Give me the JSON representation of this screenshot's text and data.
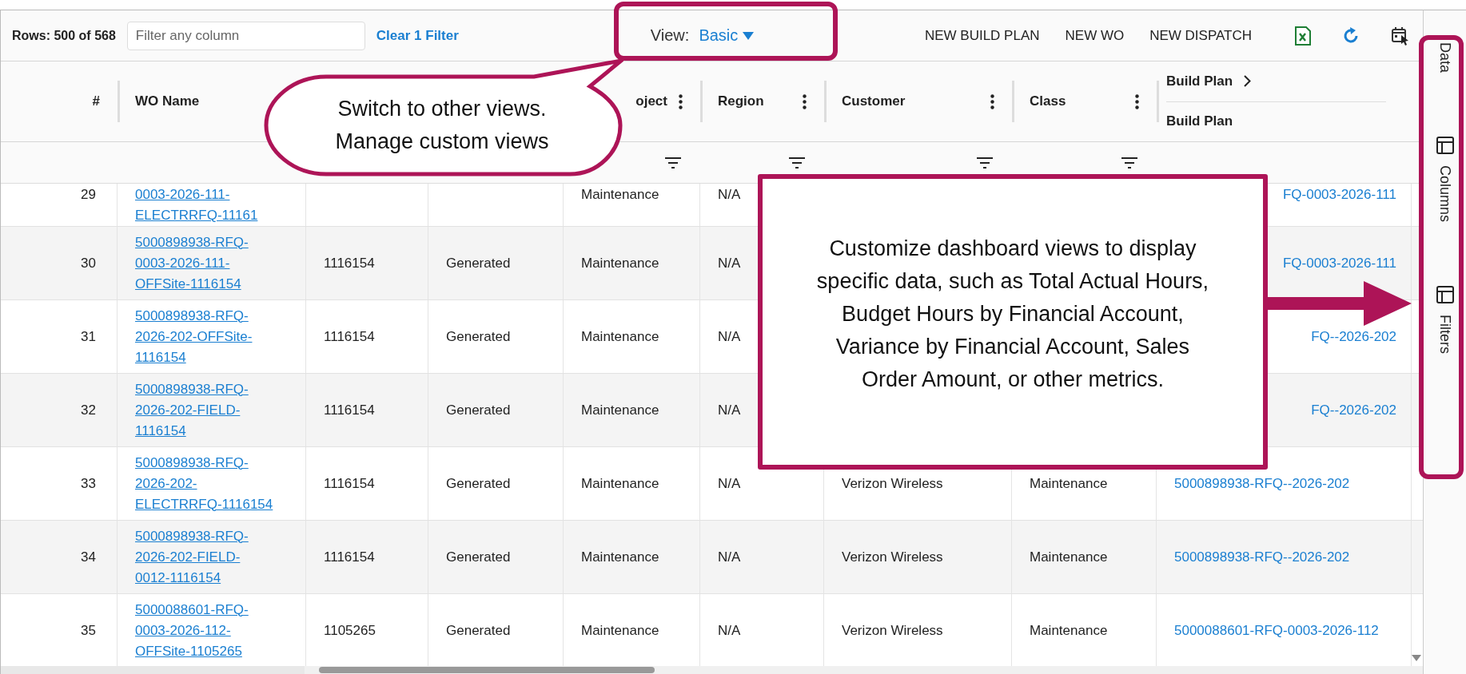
{
  "toolbar": {
    "row_count": "Rows: 500 of 568",
    "filter": {
      "placeholder": "Filter any column"
    },
    "clear_filter": "Clear 1 Filter",
    "view_label": "View:",
    "view_value": "Basic",
    "actions": [
      "NEW BUILD PLAN",
      "NEW WO",
      "NEW DISPATCH"
    ]
  },
  "columns": [
    {
      "label": "#",
      "menu": false,
      "filter": false
    },
    {
      "label": "WO Name",
      "filter": false
    },
    {},
    {},
    {
      "label": "oject",
      "menu": true,
      "filter": true
    },
    {
      "label": "Region",
      "menu": true,
      "filter": true
    },
    {
      "label": "Customer",
      "menu": true,
      "filter": true
    },
    {
      "label": "Class",
      "menu": true,
      "filter": true
    },
    {
      "group": "Build Plan",
      "label": "Build Plan",
      "filter": false
    }
  ],
  "rows": [
    {
      "number": "29",
      "wo_name": [
        "0003-2026-111-",
        "ELECTRRFQ-11161"
      ],
      "project": "Maintenance",
      "region": "N/A",
      "build_plan": "FQ-0003-2026-111",
      "build_plan_cut": true
    },
    {
      "number": "30",
      "wo_name": [
        "5000898938-RFQ-",
        "0003-2026-111-",
        "OFFSite-1116154"
      ],
      "column_3": "1116154",
      "column_4": "Generated",
      "project": "Maintenance",
      "region": "N/A",
      "build_plan": "FQ-0003-2026-111",
      "build_plan_cut": true
    },
    {
      "number": "31",
      "wo_name": [
        "5000898938-RFQ-",
        "2026-202-OFFSite-",
        "1116154"
      ],
      "column_3": "1116154",
      "column_4": "Generated",
      "project": "Maintenance",
      "region": "N/A",
      "build_plan": "FQ--2026-202",
      "build_plan_cut": true
    },
    {
      "number": "32",
      "wo_name": [
        "5000898938-RFQ-",
        "2026-202-FIELD-",
        "1116154"
      ],
      "column_3": "1116154",
      "column_4": "Generated",
      "project": "Maintenance",
      "region": "N/A",
      "build_plan": "FQ--2026-202",
      "build_plan_cut": true
    },
    {
      "number": "33",
      "wo_name": [
        "5000898938-RFQ-",
        "2026-202-",
        "ELECTRRFQ-1116154"
      ],
      "column_3": "1116154",
      "column_4": "Generated",
      "project": "Maintenance",
      "region": "N/A",
      "customer": "Verizon Wireless",
      "class": "Maintenance",
      "build_plan": "5000898938-RFQ--2026-202",
      "build_plan_cut": false
    },
    {
      "number": "34",
      "wo_name": [
        "5000898938-RFQ-",
        "2026-202-FIELD-",
        "0012-1116154"
      ],
      "column_3": "1116154",
      "column_4": "Generated",
      "project": "Maintenance",
      "region": "N/A",
      "customer": "Verizon Wireless",
      "class": "Maintenance",
      "build_plan": "5000898938-RFQ--2026-202",
      "build_plan_cut": false
    },
    {
      "number": "35",
      "wo_name": [
        "5000088601-RFQ-",
        "0003-2026-112-",
        "OFFSite-1105265"
      ],
      "column_3": "1105265",
      "column_4": "Generated",
      "project": "Maintenance",
      "region": "N/A",
      "customer": "Verizon Wireless",
      "class": "Maintenance",
      "build_plan": "5000088601-RFQ-0003-2026-112",
      "build_plan_cut": false
    }
  ],
  "side_panel": [
    {
      "label": "Data",
      "has_icon": false
    },
    {
      "label": "Columns",
      "has_icon": true
    },
    {
      "label": "Filters",
      "has_icon": true
    }
  ],
  "annotations": [
    {
      "kind": "speech_bubble",
      "lines": [
        "Switch to other views.",
        "Manage custom views"
      ]
    },
    {
      "kind": "note",
      "lines": [
        "Customize dashboard views to display",
        "specific data, such as Total Actual Hours,",
        "Budget Hours by Financial Account,",
        "Variance by Financial Account, Sales",
        "Order Amount, or other metrics."
      ]
    }
  ]
}
